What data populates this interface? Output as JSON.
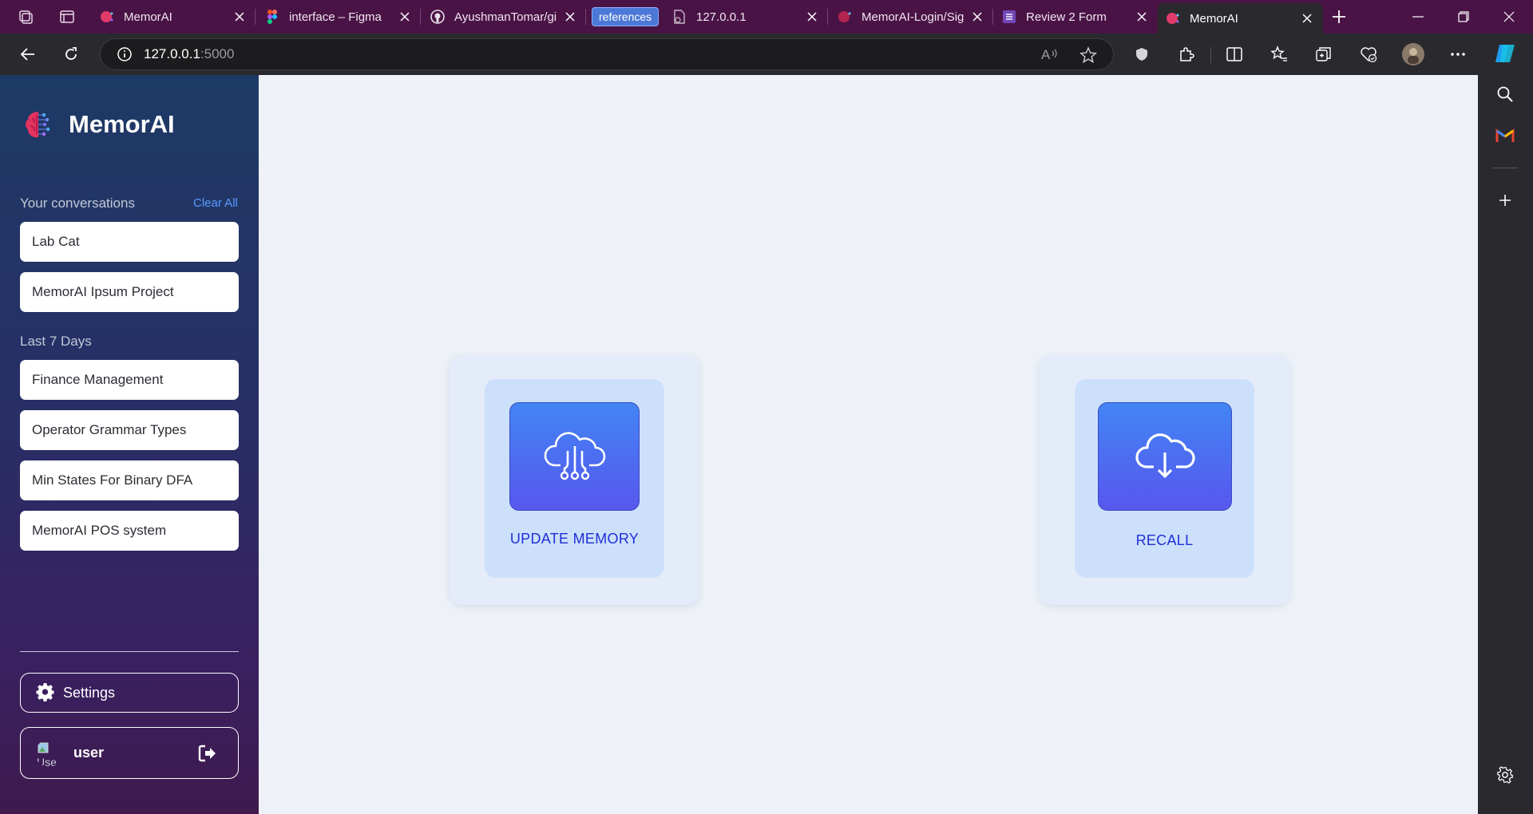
{
  "browser": {
    "tabs": [
      {
        "label": "MemorAI",
        "icon": "memorai-brain-icon"
      },
      {
        "label": "interface – Figma",
        "icon": "figma-icon"
      },
      {
        "label": "AyushmanTomar/gi",
        "icon": "github-icon"
      },
      {
        "label": "references",
        "icon": "tab-group-pill"
      },
      {
        "label": "127.0.0.1",
        "icon": "page-error-icon"
      },
      {
        "label": "MemorAI-Login/Sig",
        "icon": "memorai-brain-icon"
      },
      {
        "label": "Review 2 Form",
        "icon": "forms-icon"
      },
      {
        "label": "MemorAI",
        "icon": "memorai-brain-icon",
        "active": true
      }
    ],
    "url_host": "127.0.0.1",
    "url_port": ":5000",
    "accent": "#4a1346"
  },
  "sidebar": {
    "brand": "MemorAI",
    "conversations_title": "Your conversations",
    "clear_all": "Clear All",
    "conversations": [
      "Lab Cat",
      "MemorAI Ipsum Project"
    ],
    "last7_title": "Last 7 Days",
    "last7": [
      "Finance Management",
      "Operator Grammar Types",
      "Min States For Binary DFA",
      "MemorAI POS system"
    ],
    "settings_label": "Settings",
    "user_name": "user",
    "avatar_alt": "Use"
  },
  "main": {
    "update_memory_label": "UPDATE MEMORY",
    "recall_label": "RECALL",
    "accent": "#1d2fd6"
  }
}
